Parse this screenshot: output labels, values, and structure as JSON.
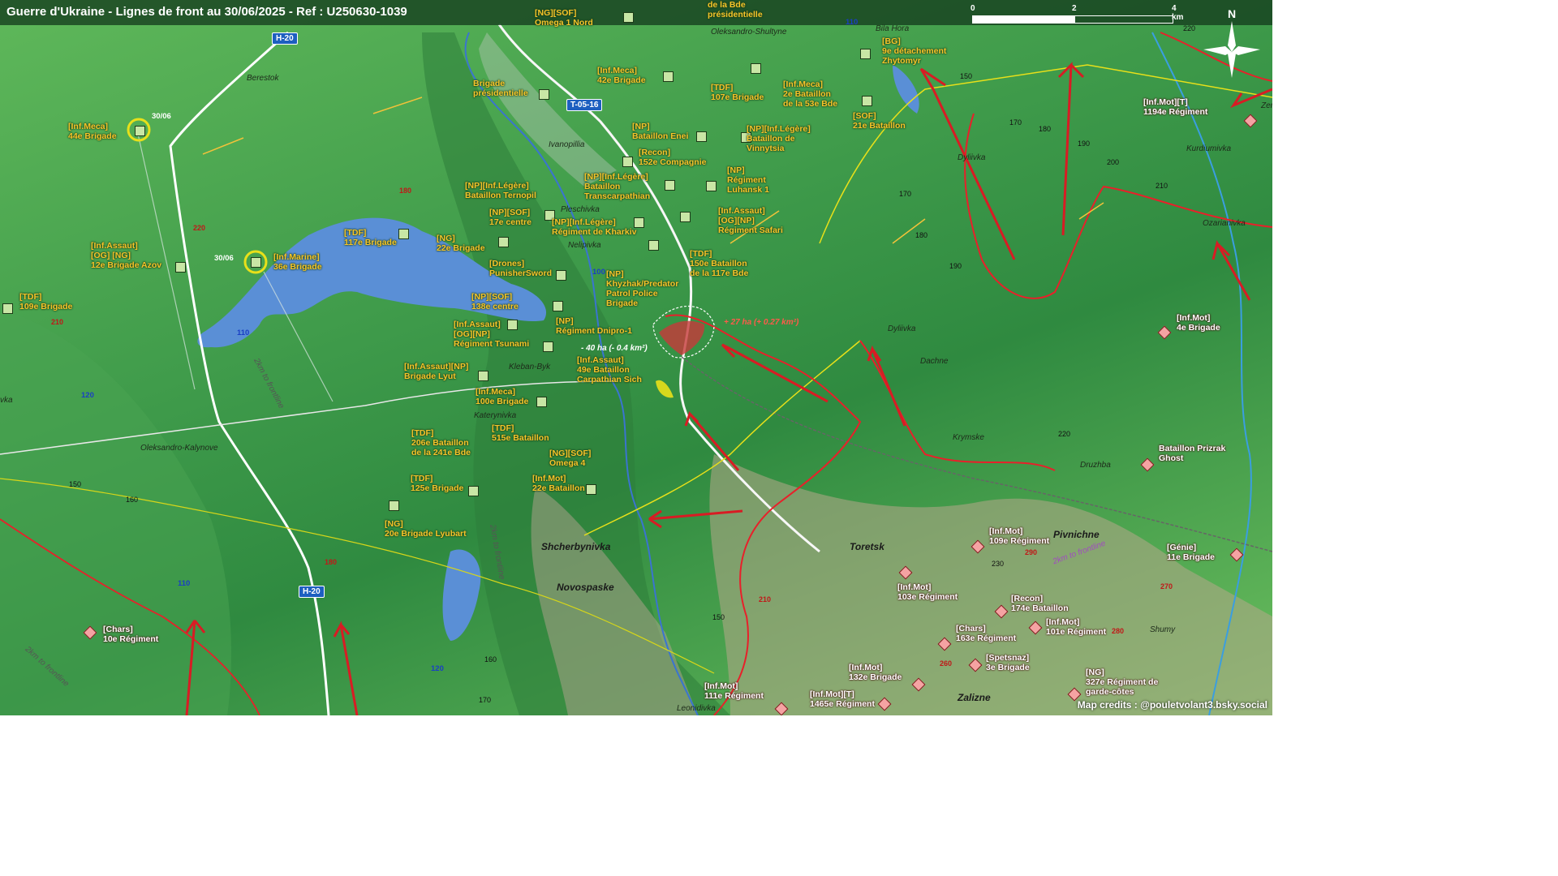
{
  "title": "Guerre d'Ukraine - Lignes de front au 30/06/2025 - Ref : U250630-1039",
  "scale": {
    "ticks": [
      "0",
      "2",
      "4 km"
    ]
  },
  "north": "N",
  "credits": "Map credits : @pouletvolant3.bsky.social",
  "colors": {
    "ua_unit": "#f6c42a",
    "ru_unit": "#ffffff",
    "front_line": "#e8202a",
    "water": "#5a8fd6",
    "gain": "#ff5a4a",
    "loss": "#ffffff"
  },
  "road_shields": [
    "H-20",
    "T-05-16",
    "H-20"
  ],
  "towns": [
    "Shcherbynivka",
    "Novospaske",
    "Toretsk",
    "Pivnichne",
    "Zalizne"
  ],
  "places": [
    "Berestok",
    "Ivanopillia",
    "Pleschivka",
    "Nelipivka",
    "Kleban-Byk",
    "Katerynivka",
    "Oleksandro-Kalynove",
    "Oleksandro-Shultyne",
    "Bila Hora",
    "Dyliivka",
    "Kurdiumivka",
    "Ozarianivka",
    "Dachne",
    "Krymske",
    "Druzhba",
    "Shumy",
    "Leonidivka",
    "Dyliivka",
    "vka",
    "Zer"
  ],
  "road_numbers": [
    "110",
    "100",
    "110",
    "120",
    "110",
    "120"
  ],
  "contours": [
    "180",
    "220",
    "210",
    "150",
    "160",
    "180",
    "170",
    "180",
    "190",
    "200",
    "210",
    "170",
    "180",
    "190",
    "150",
    "160",
    "170",
    "150",
    "220",
    "230",
    "290",
    "270",
    "280",
    "260",
    "210",
    "220"
  ],
  "frontline_notes": [
    "2km to frontline",
    "2km to frontline",
    "2km to frontline",
    "2km to frontline"
  ],
  "dates": [
    "30/06",
    "30/06"
  ],
  "changes": [
    {
      "text": "+ 27 ha (+ 0.27 km²)",
      "color": "#ff5a4a"
    },
    {
      "text": "- 40 ha (- 0.4 km²)",
      "color": "#ffffff"
    }
  ],
  "ua_units": [
    "[NG][SOF]\nOmega 1 Nord",
    "de la Bde\nprésidentielle",
    "[Inf.Meca]\n42e Brigade",
    "Brigade\nprésidentielle",
    "[Inf.Meca]\n44e Brigade",
    "[TDF]\n107e Brigade",
    "[Inf.Meca]\n2e Bataillon\nde la 53e Bde",
    "[BG]\n9e détachement\nZhytomyr",
    "[SOF]\n21e Bataillon",
    "[NP]\nBataillon Enei",
    "[NP][Inf.Légère]\nBataillon de\nVinnytsia",
    "[Recon]\n152e Compagnie",
    "[NP][Inf.Légère]\nBataillon\nTranscarpathian",
    "[NP]\nRégiment\nLuhansk 1",
    "[NP][Inf.Légère]\nBataillon Ternopil",
    "[NP][SOF]\n17e centre",
    "[NP][Inf.Légère]\nRégiment de Kharkiv",
    "[Inf.Assaut]\n[OG][NP]\nRégiment Safari",
    "[TDF]\n117e Brigade",
    "[NG]\n22e Brigade",
    "[Inf.Assaut]\n[OG] [NG]\n12e Brigade Azov",
    "[Inf.Marine]\n36e Brigade",
    "[TDF]\n150e Bataillon\nde la 117e Bde",
    "[Drones]\nPunisherSword",
    "[NP]\nKhyzhak/Predator\nPatrol Police\nBrigade",
    "[TDF]\n109e Brigade",
    "[NP][SOF]\n138e centre",
    "[NP]\nRégiment Dnipro-1",
    "[Inf.Assaut]\n[OG][NP]\nRégiment Tsunami",
    "[Inf.Assaut]\n49e Bataillon\nCarpathian Sich",
    "[Inf.Assaut][NP]\nBrigade Lyut",
    "[Inf.Meca]\n100e Brigade",
    "[TDF]\n206e Bataillon\nde la 241e Bde",
    "[TDF]\n515e Bataillon",
    "[NG][SOF]\nOmega 4",
    "[TDF]\n125e Brigade",
    "[Inf.Mot]\n22e Bataillon",
    "[NG]\n20e Brigade Lyubart"
  ],
  "ru_units": [
    "[Inf.Mot][T]\n1194e Régiment",
    "[Inf.Mot]\n4e Brigade",
    "Bataillon Prizrak\nGhost",
    "[Inf.Mot]\n109e Régiment",
    "[Génie]\n11e Brigade",
    "[Inf.Mot]\n103e Régiment",
    "[Recon]\n174e Bataillon",
    "[Inf.Mot]\n101e Régiment",
    "[Chars]\n163e Régiment",
    "[Chars]\n10e Régiment",
    "[Inf.Mot]\n132e Brigade",
    "[Spetsnaz]\n3e Brigade",
    "[NG]\n327e Régiment de\ngarde-côtes",
    "[Inf.Mot]\n111e Régiment",
    "[Inf.Mot][T]\n1465e Régiment"
  ]
}
